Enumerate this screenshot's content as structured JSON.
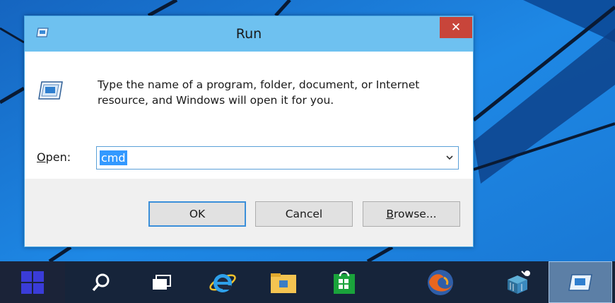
{
  "dialog": {
    "title": "Run",
    "close_symbol": "✕",
    "description": "Type the name of a program, folder, document, or Internet resource, and Windows will open it for you.",
    "open_label_accel": "O",
    "open_label_rest": "pen:",
    "input_value": "cmd",
    "ok_label": "OK",
    "cancel_label": "Cancel",
    "browse_label_accel": "B",
    "browse_label_rest": "rowse..."
  },
  "icons": {
    "title": "run-icon",
    "big": "run-icon",
    "dropdown": "chevron-down-icon",
    "close": "close-icon"
  },
  "taskbar": {
    "items": [
      "start-button",
      "search",
      "task-view",
      "internet-explorer",
      "file-explorer",
      "store",
      "firefox",
      "installer",
      "run"
    ]
  },
  "colors": {
    "titlebar": "#6ec1f0",
    "close": "#c8453a",
    "selection": "#3399ff",
    "taskbar": "#16243a",
    "desktop": "#1e7fd6"
  }
}
